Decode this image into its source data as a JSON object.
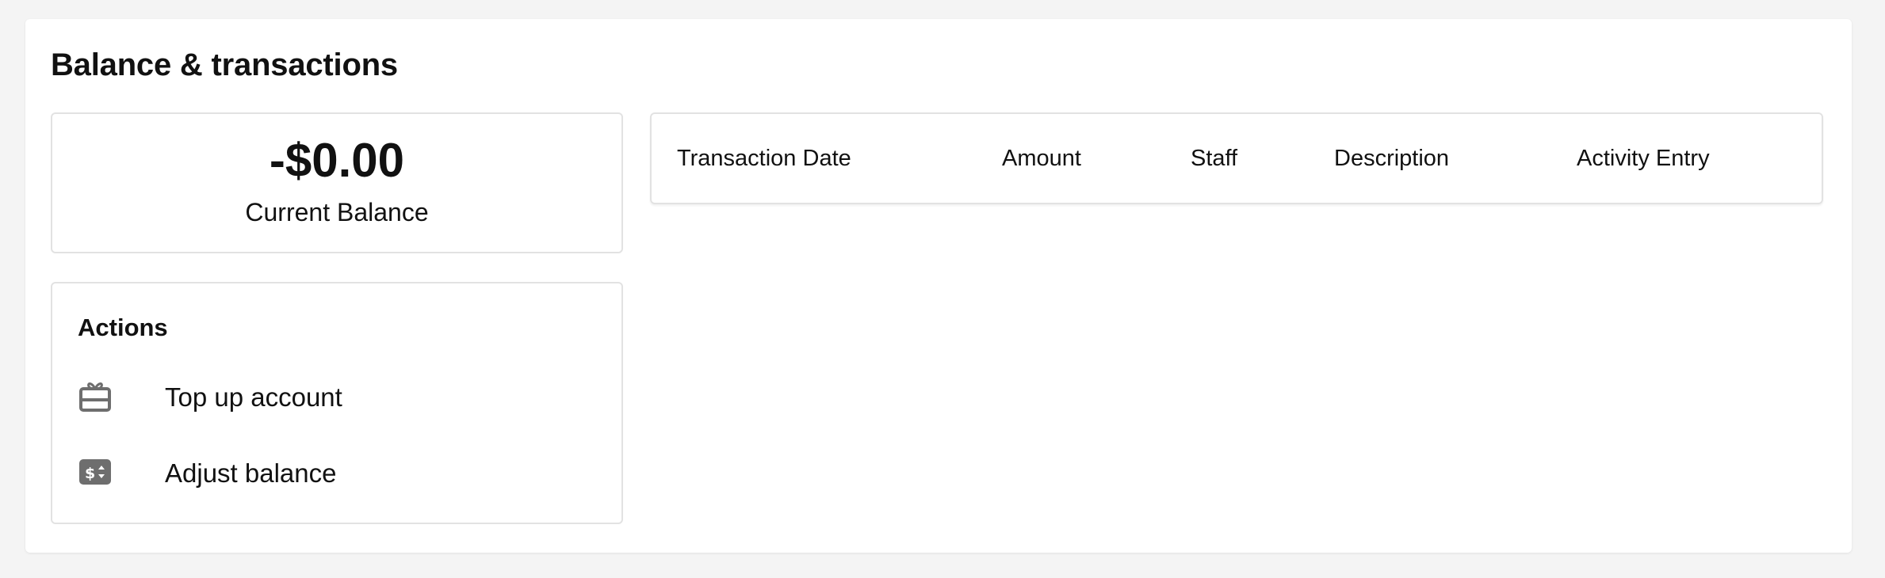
{
  "section": {
    "title": "Balance & transactions"
  },
  "balance": {
    "amount": "-$0.00",
    "label": "Current Balance"
  },
  "actions": {
    "title": "Actions",
    "items": [
      {
        "label": "Top up account",
        "icon": "gift-card-icon"
      },
      {
        "label": "Adjust balance",
        "icon": "dollar-adjust-icon"
      }
    ]
  },
  "transactions_table": {
    "columns": [
      "Transaction Date",
      "Amount",
      "Staff",
      "Description",
      "Activity Entry"
    ],
    "rows": []
  },
  "colors": {
    "page_background": "#f4f4f4",
    "card_background": "#ffffff",
    "border": "#e2e2e2",
    "icon": "#6e6e6e",
    "text": "#111111"
  }
}
